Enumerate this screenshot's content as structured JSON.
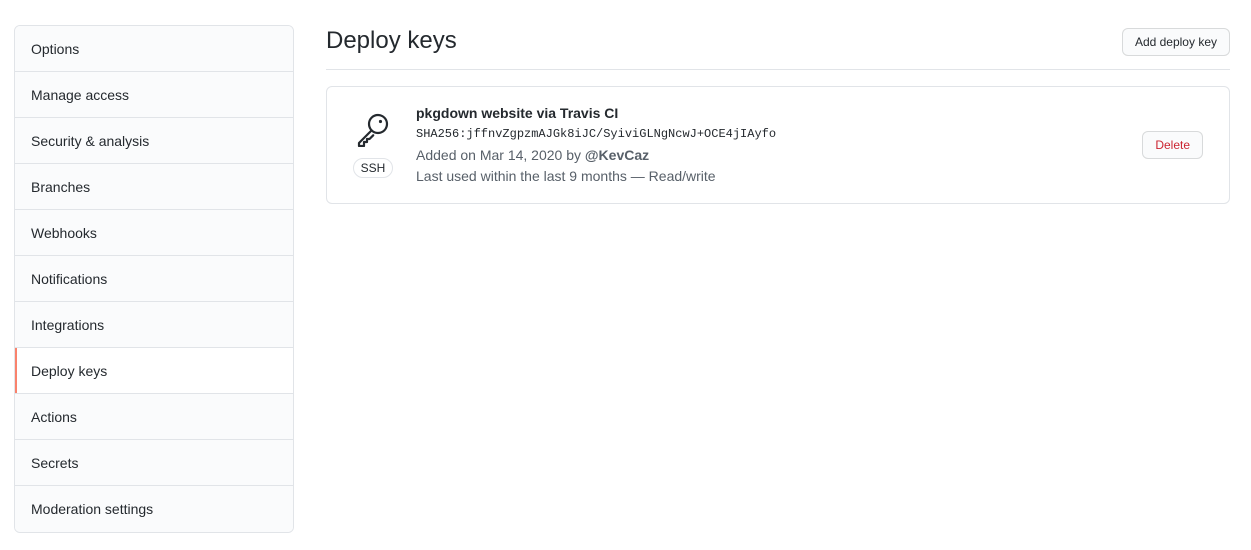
{
  "sidebar": {
    "items": [
      {
        "label": "Options"
      },
      {
        "label": "Manage access"
      },
      {
        "label": "Security & analysis"
      },
      {
        "label": "Branches"
      },
      {
        "label": "Webhooks"
      },
      {
        "label": "Notifications"
      },
      {
        "label": "Integrations"
      },
      {
        "label": "Deploy keys"
      },
      {
        "label": "Actions"
      },
      {
        "label": "Secrets"
      },
      {
        "label": "Moderation settings"
      }
    ],
    "selected": "Deploy keys",
    "accent_color": "#f9826c"
  },
  "main": {
    "title": "Deploy keys",
    "add_button_label": "Add deploy key",
    "keys": [
      {
        "icon": "key-icon",
        "type_label": "SSH",
        "title": "pkgdown website via Travis CI",
        "fingerprint": "SHA256:jffnvZgpzmAJGk8iJC/SyiviGLNgNcwJ+OCE4jIAyfo",
        "added_prefix": "Added on Mar 14, 2020 by",
        "author": "@KevCaz",
        "last_used": "Last used within the last 9 months — Read/write",
        "delete_label": "Delete",
        "delete_color": "#cb2431"
      }
    ]
  }
}
